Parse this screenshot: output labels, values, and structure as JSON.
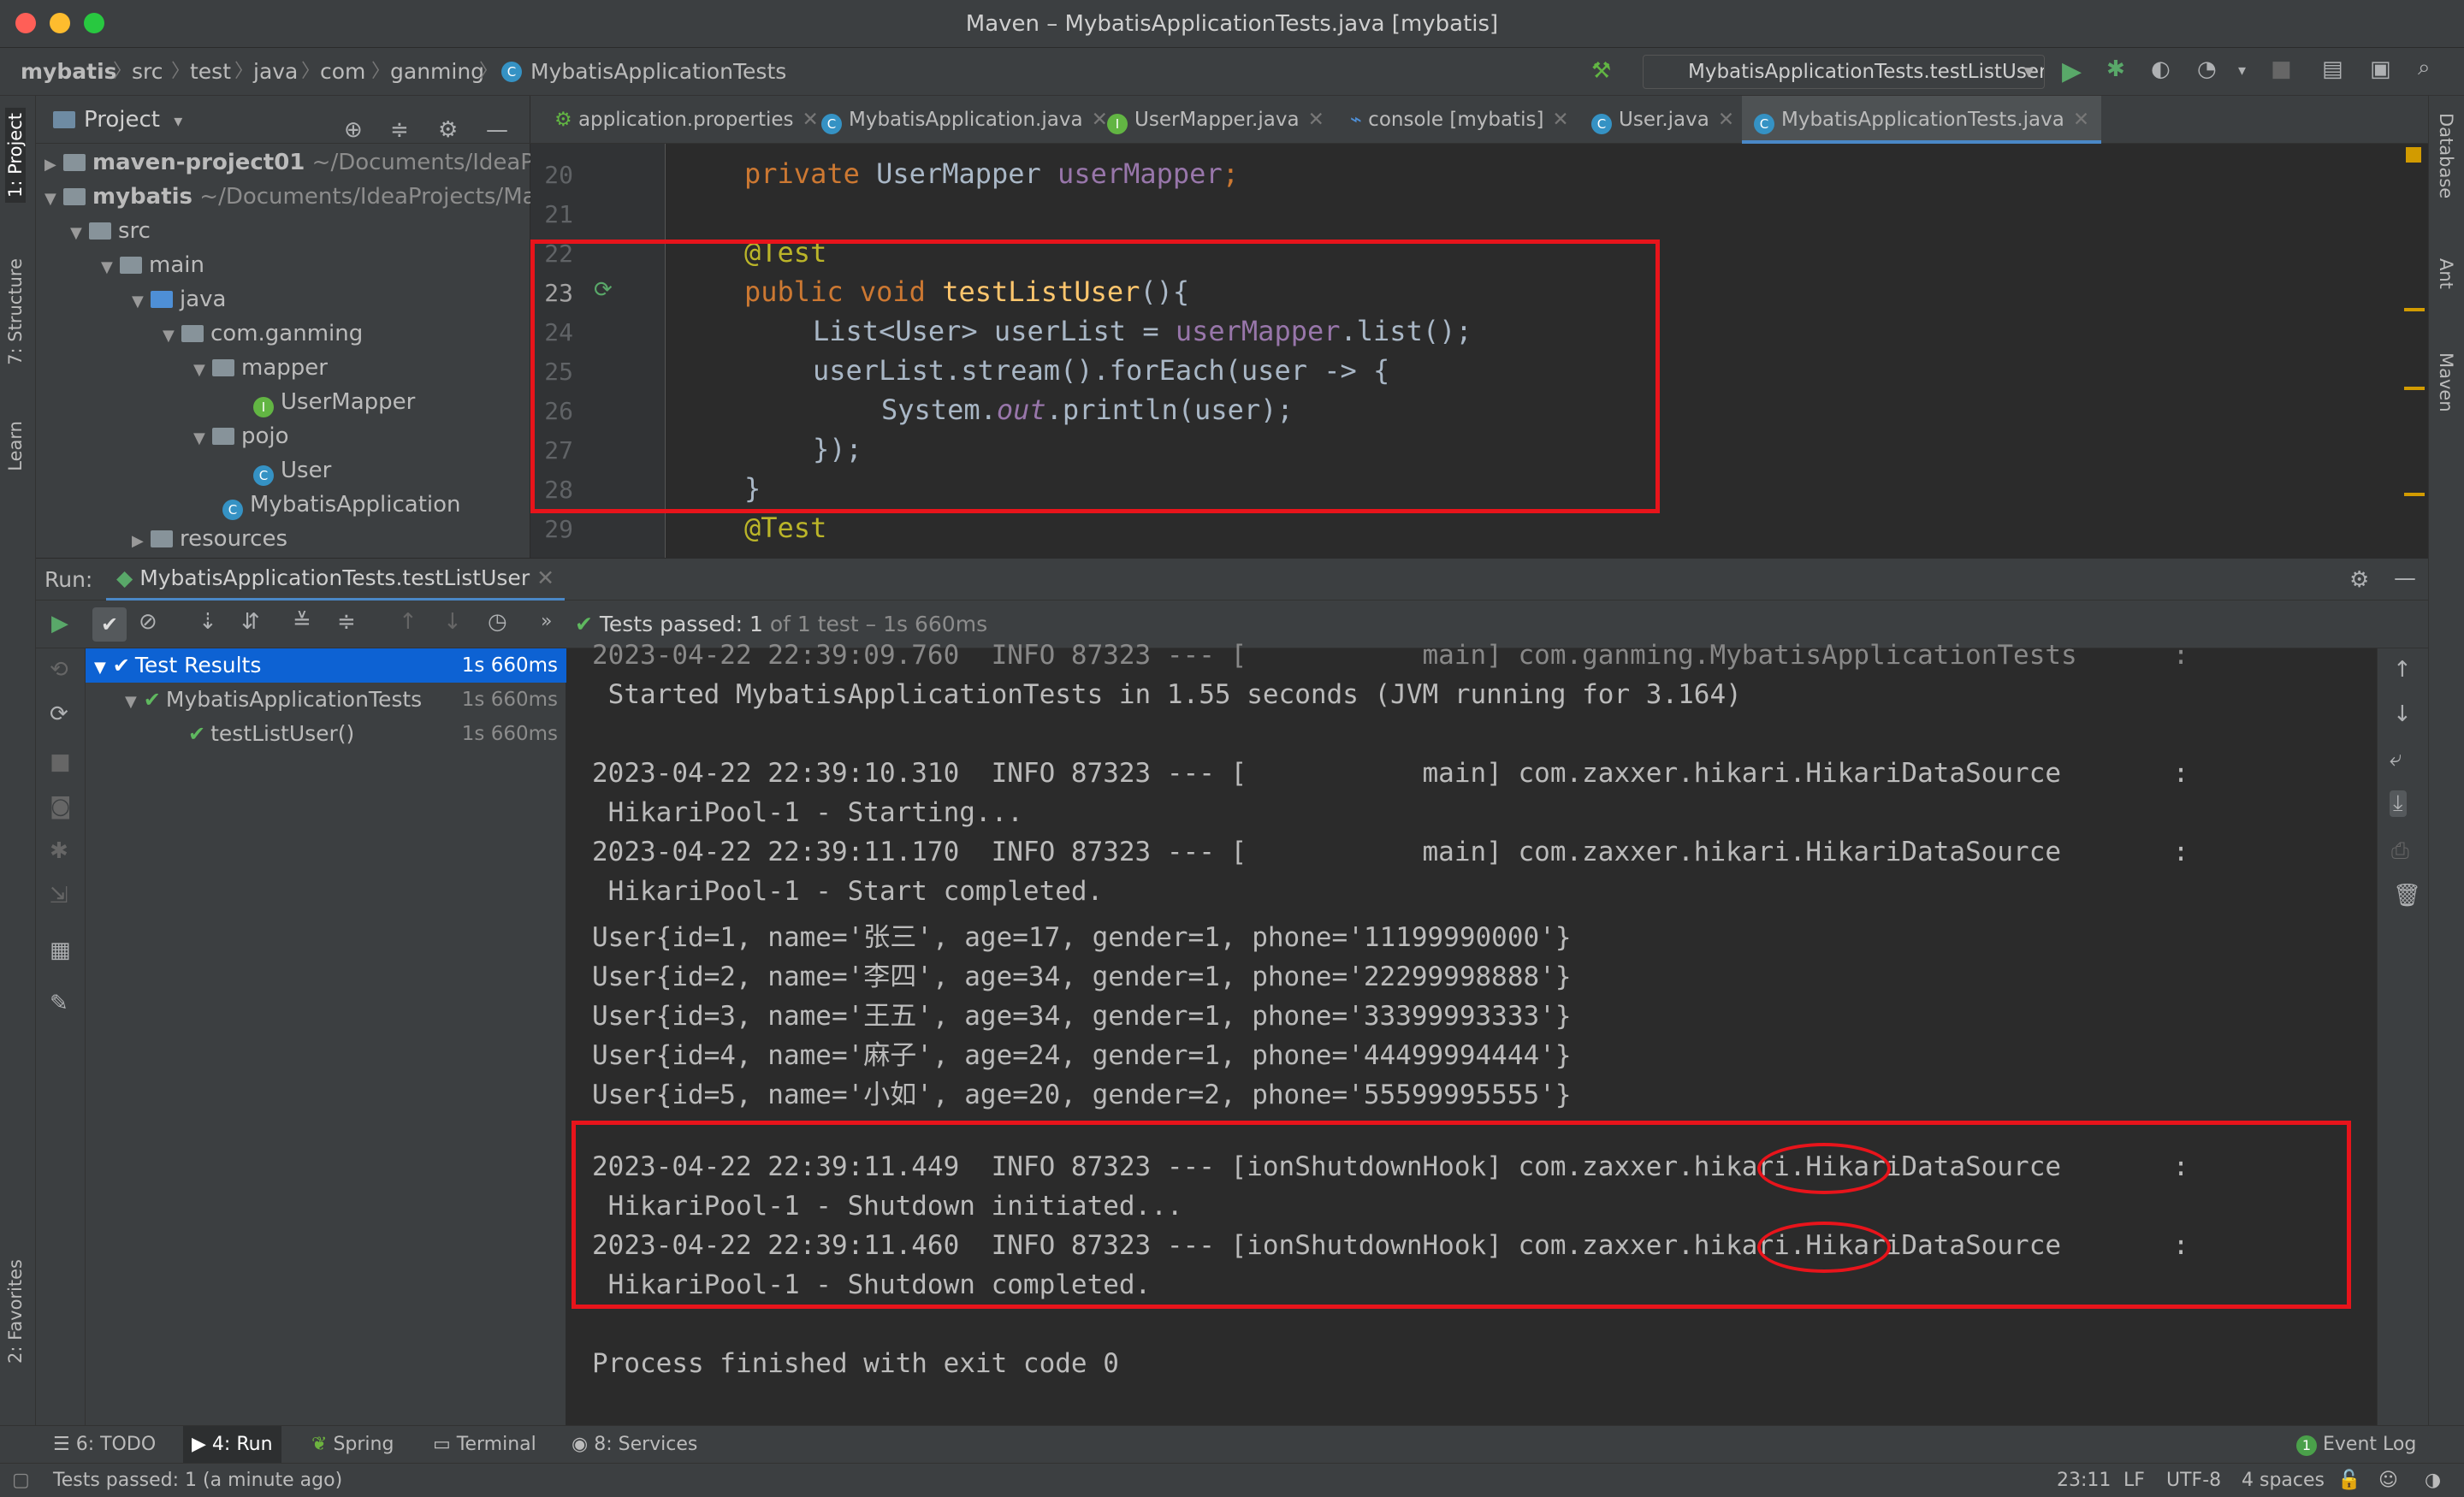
{
  "window": {
    "title": "Maven – MybatisApplicationTests.java [mybatis]"
  },
  "breadcrumbs": [
    "mybatis",
    "src",
    "test",
    "java",
    "com",
    "ganming",
    "MybatisApplicationTests"
  ],
  "run_config": {
    "selected": "MybatisApplicationTests.testListUser"
  },
  "left_tools": [
    "1: Project",
    "7: Structure",
    "Learn",
    "2: Favorites"
  ],
  "right_tools": [
    "Database",
    "Ant",
    "Maven"
  ],
  "project_panel": {
    "title": "Project",
    "tree": [
      {
        "label": "maven-project01",
        "path": "~/Documents/IdeaPro"
      },
      {
        "label": "mybatis",
        "path": "~/Documents/IdeaProjects/Ma"
      },
      {
        "label": "src"
      },
      {
        "label": "main"
      },
      {
        "label": "java"
      },
      {
        "label": "com.ganming"
      },
      {
        "label": "mapper"
      },
      {
        "label": "UserMapper"
      },
      {
        "label": "pojo"
      },
      {
        "label": "User"
      },
      {
        "label": "MybatisApplication"
      },
      {
        "label": "resources"
      }
    ]
  },
  "editor_tabs": [
    {
      "label": "application.properties"
    },
    {
      "label": "MybatisApplication.java"
    },
    {
      "label": "UserMapper.java"
    },
    {
      "label": "console [mybatis]"
    },
    {
      "label": "User.java"
    },
    {
      "label": "MybatisApplicationTests.java",
      "active": true
    }
  ],
  "editor": {
    "line_numbers": [
      "20",
      "21",
      "22",
      "23",
      "24",
      "25",
      "26",
      "27",
      "28",
      "29"
    ],
    "lines": {
      "l20": {
        "kw": "private ",
        "type": "UserMapper ",
        "field": "userMapper",
        "end": ";"
      },
      "l22": "@Test",
      "l23": {
        "kw": "public void ",
        "fn": "testListUser",
        "end": "(){"
      },
      "l24": {
        "a": "List<User> userList = ",
        "field": "userMapper",
        "b": ".list();"
      },
      "l25": {
        "a": "userList.stream().forEach(user -> {"
      },
      "l26": {
        "a": "System.",
        "italic": "out",
        "b": ".println(user);"
      },
      "l27": "});",
      "l28": "}",
      "l29": "@Test"
    }
  },
  "run": {
    "label": "Run:",
    "tab": "MybatisApplicationTests.testListUser",
    "status_strong": "Tests passed: 1",
    "status_rest": " of 1 test – 1s 660ms",
    "results": [
      {
        "label": "Test Results",
        "time": "1s 660ms"
      },
      {
        "label": "MybatisApplicationTests",
        "time": "1s 660ms"
      },
      {
        "label": "testListUser()",
        "time": "1s 660ms"
      }
    ],
    "console": [
      "2023-04-22 22:39:09.760  INFO 87323 --- [           main] com.ganming.MybatisApplicationTests      :",
      " Started MybatisApplicationTests in 1.55 seconds (JVM running for 3.164)",
      "",
      "2023-04-22 22:39:10.310  INFO 87323 --- [           main] com.zaxxer.hikari.HikariDataSource       :",
      " HikariPool-1 - Starting...",
      "2023-04-22 22:39:11.170  INFO 87323 --- [           main] com.zaxxer.hikari.HikariDataSource       :",
      " HikariPool-1 - Start completed.",
      "User{id=1, name='张三', age=17, gender=1, phone='11199990000'}",
      "User{id=2, name='李四', age=34, gender=1, phone='22299998888'}",
      "User{id=3, name='王五', age=34, gender=1, phone='33399993333'}",
      "User{id=4, name='麻子', age=24, gender=1, phone='44499994444'}",
      "User{id=5, name='小如', age=20, gender=2, phone='55599995555'}",
      "",
      "2023-04-22 22:39:11.449  INFO 87323 --- [ionShutdownHook] com.zaxxer.hikari.HikariDataSource       :",
      " HikariPool-1 - Shutdown initiated...",
      "2023-04-22 22:39:11.460  INFO 87323 --- [ionShutdownHook] com.zaxxer.hikari.HikariDataSource       :",
      " HikariPool-1 - Shutdown completed.",
      "",
      "Process finished with exit code 0"
    ]
  },
  "tool_buttons": [
    {
      "label": "6: TODO"
    },
    {
      "label": "4: Run",
      "active": true
    },
    {
      "label": "Spring"
    },
    {
      "label": "Terminal"
    },
    {
      "label": "8: Services"
    },
    {
      "label": "Event Log",
      "badge": "1"
    }
  ],
  "status": {
    "message": "Tests passed: 1 (a minute ago)",
    "position": "23:11",
    "line_sep": "LF",
    "encoding": "UTF-8",
    "indent": "4 spaces"
  },
  "colors": {
    "annotation_red": "#e8141b",
    "selection_blue": "#0d62d3",
    "pass_green": "#5fb85f"
  }
}
